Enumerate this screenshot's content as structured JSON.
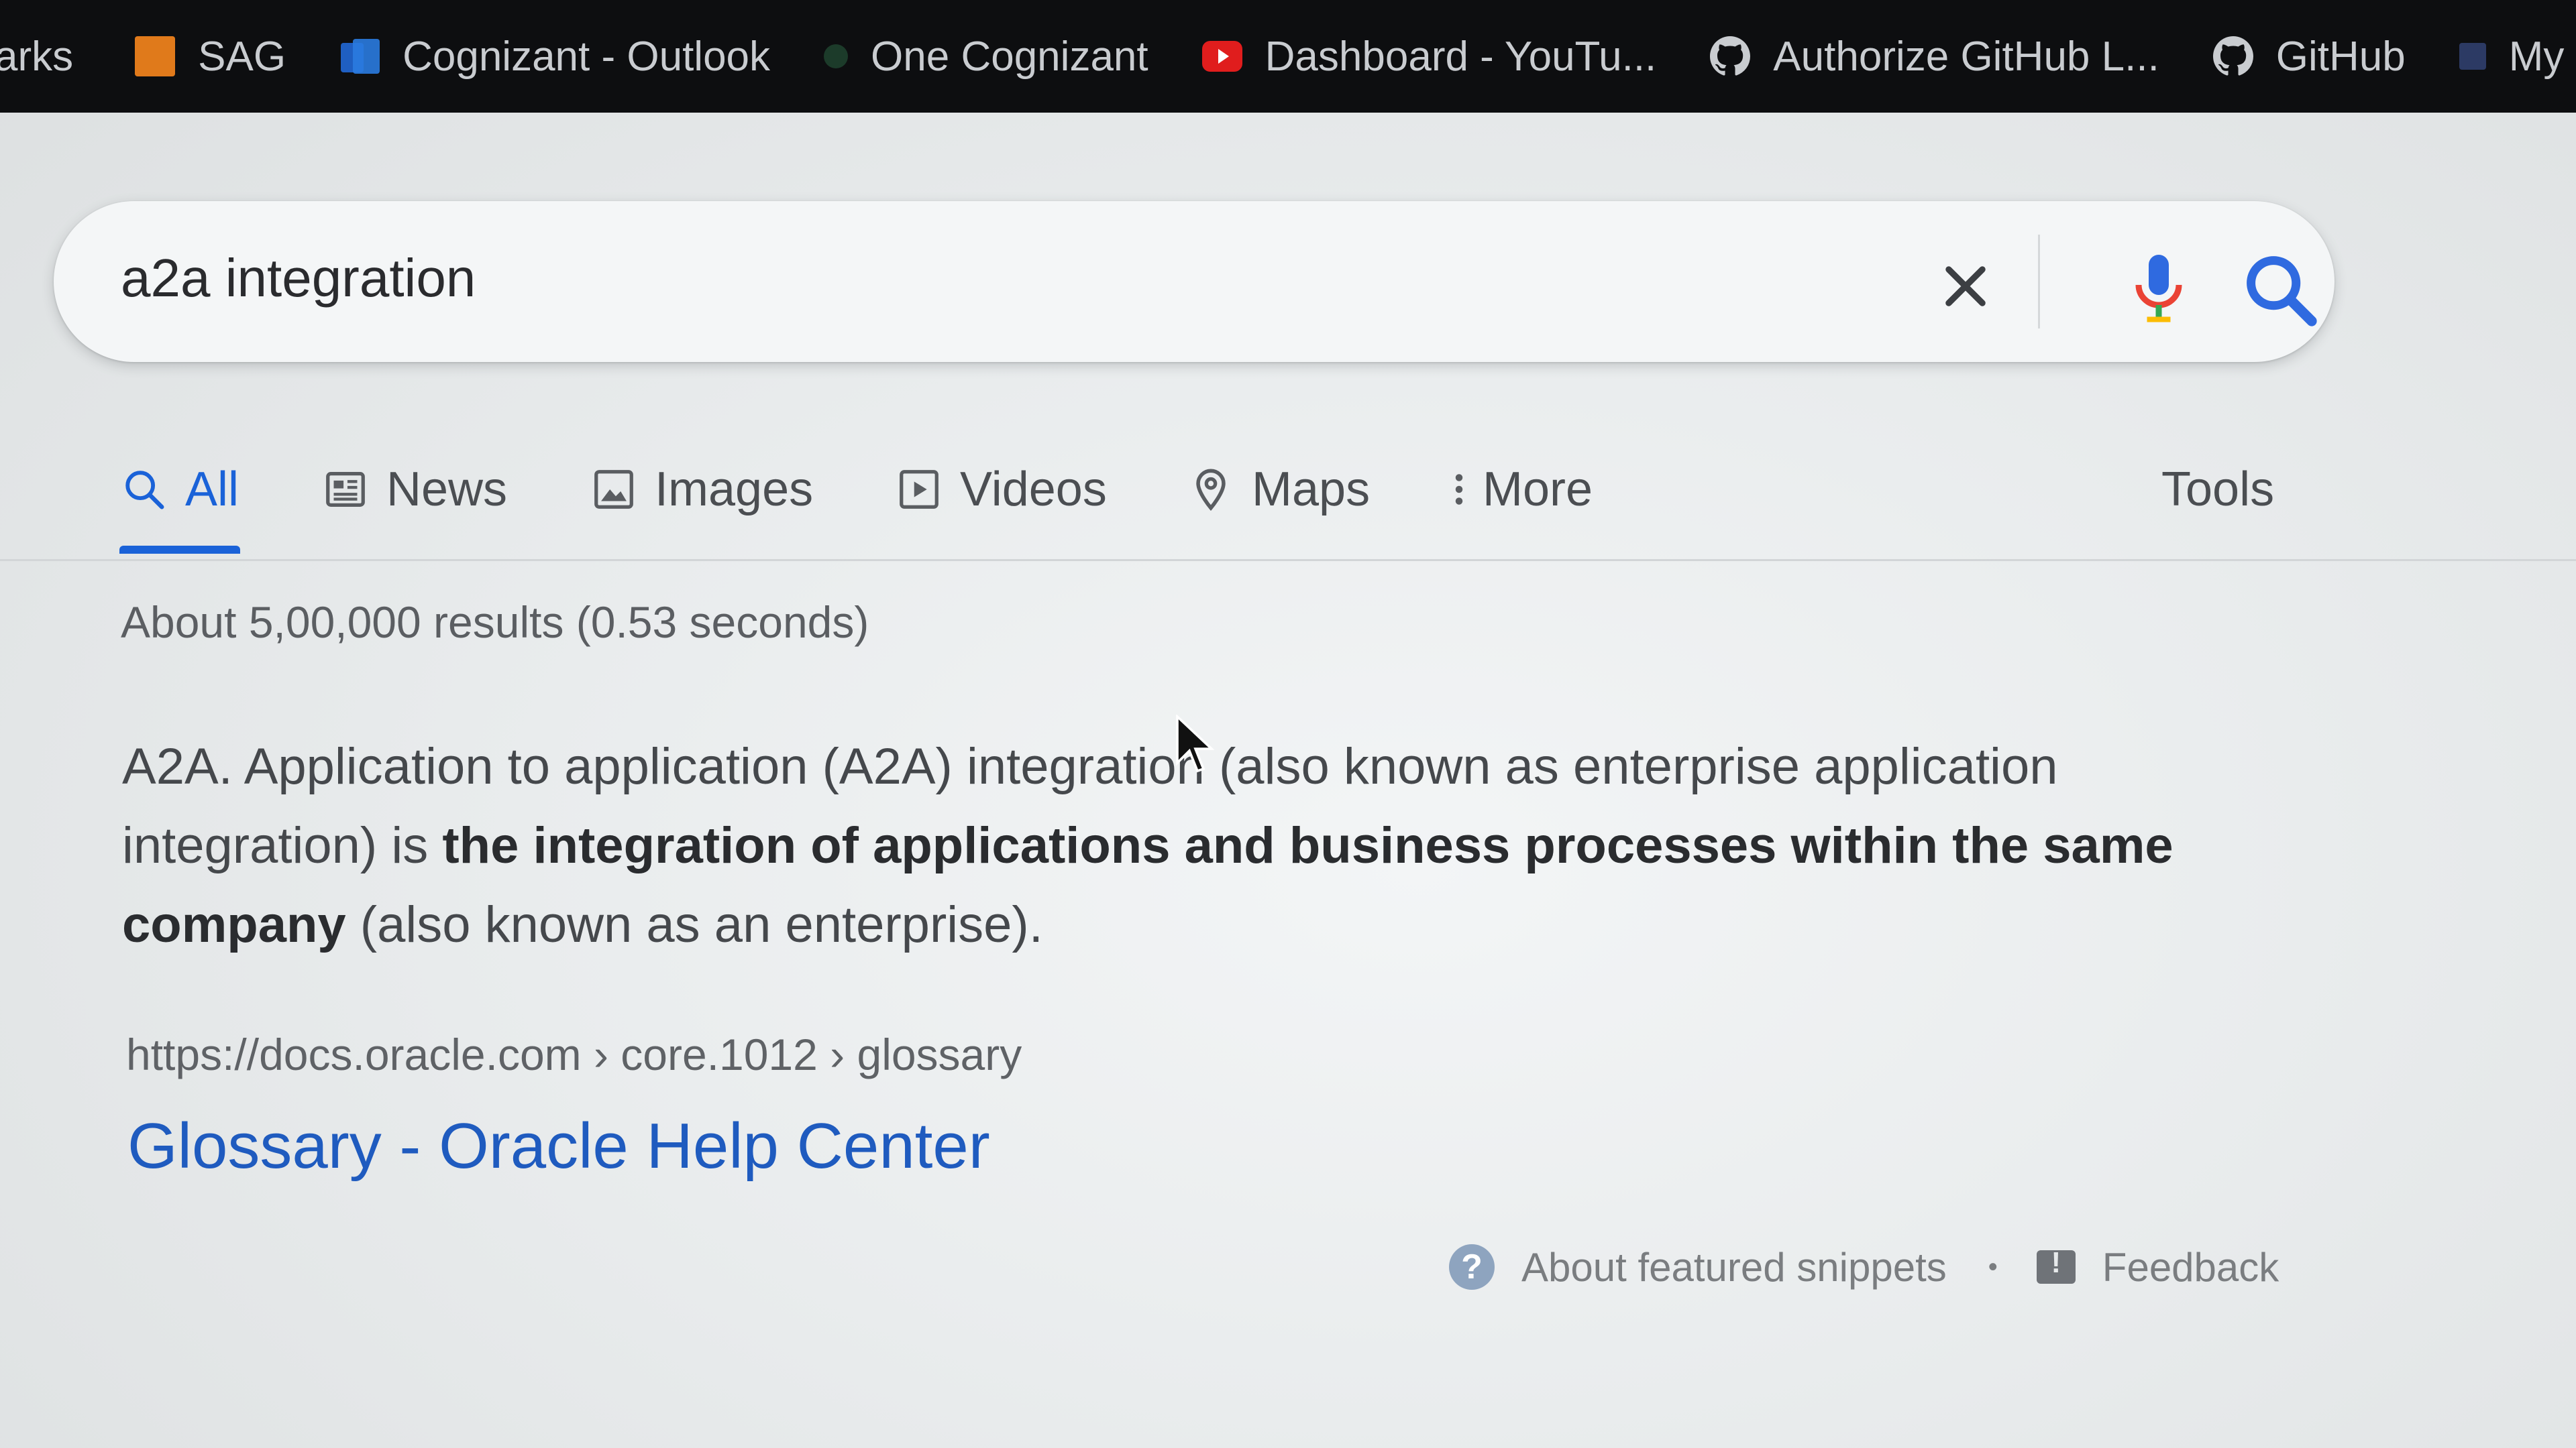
{
  "bookmarks": [
    {
      "label": "arks",
      "icon": "none"
    },
    {
      "label": "SAG",
      "icon": "sag-icon"
    },
    {
      "label": "Cognizant - Outlook",
      "icon": "outlook-icon"
    },
    {
      "label": "One Cognizant",
      "icon": "cognizant-icon"
    },
    {
      "label": "Dashboard - YouTu...",
      "icon": "youtube-icon"
    },
    {
      "label": "Authorize GitHub L...",
      "icon": "github-icon"
    },
    {
      "label": "GitHub",
      "icon": "github-icon"
    },
    {
      "label": "My",
      "icon": "generic-icon"
    }
  ],
  "search": {
    "query": "a2a integration",
    "clear_icon": "close-icon",
    "mic_icon": "microphone-icon",
    "search_icon": "search-icon"
  },
  "tabs": [
    {
      "label": "All",
      "icon": "search-icon",
      "active": true
    },
    {
      "label": "News",
      "icon": "news-icon"
    },
    {
      "label": "Images",
      "icon": "image-icon"
    },
    {
      "label": "Videos",
      "icon": "video-icon"
    },
    {
      "label": "Maps",
      "icon": "map-pin-icon"
    },
    {
      "label": "More",
      "icon": "more-vertical-icon"
    }
  ],
  "tools_label": "Tools",
  "result_stats": "About 5,00,000 results (0.53 seconds)",
  "snippet": {
    "part1": "A2A. Application to application (A2A) integration (also known as enterprise application integration) is ",
    "bold1": "the integration of applications and business processes within the same company",
    "part2": " (also known as an enterprise)."
  },
  "result": {
    "cite": "https://docs.oracle.com › core.1012 › glossary",
    "title": "Glossary - Oracle Help Center"
  },
  "footer": {
    "about_snippets": "About featured snippets",
    "separator": "•",
    "feedback": "Feedback"
  },
  "colors": {
    "accent": "#1a62d8",
    "link": "#1f5bbf",
    "bookmarks_bg": "#0d0e10"
  }
}
